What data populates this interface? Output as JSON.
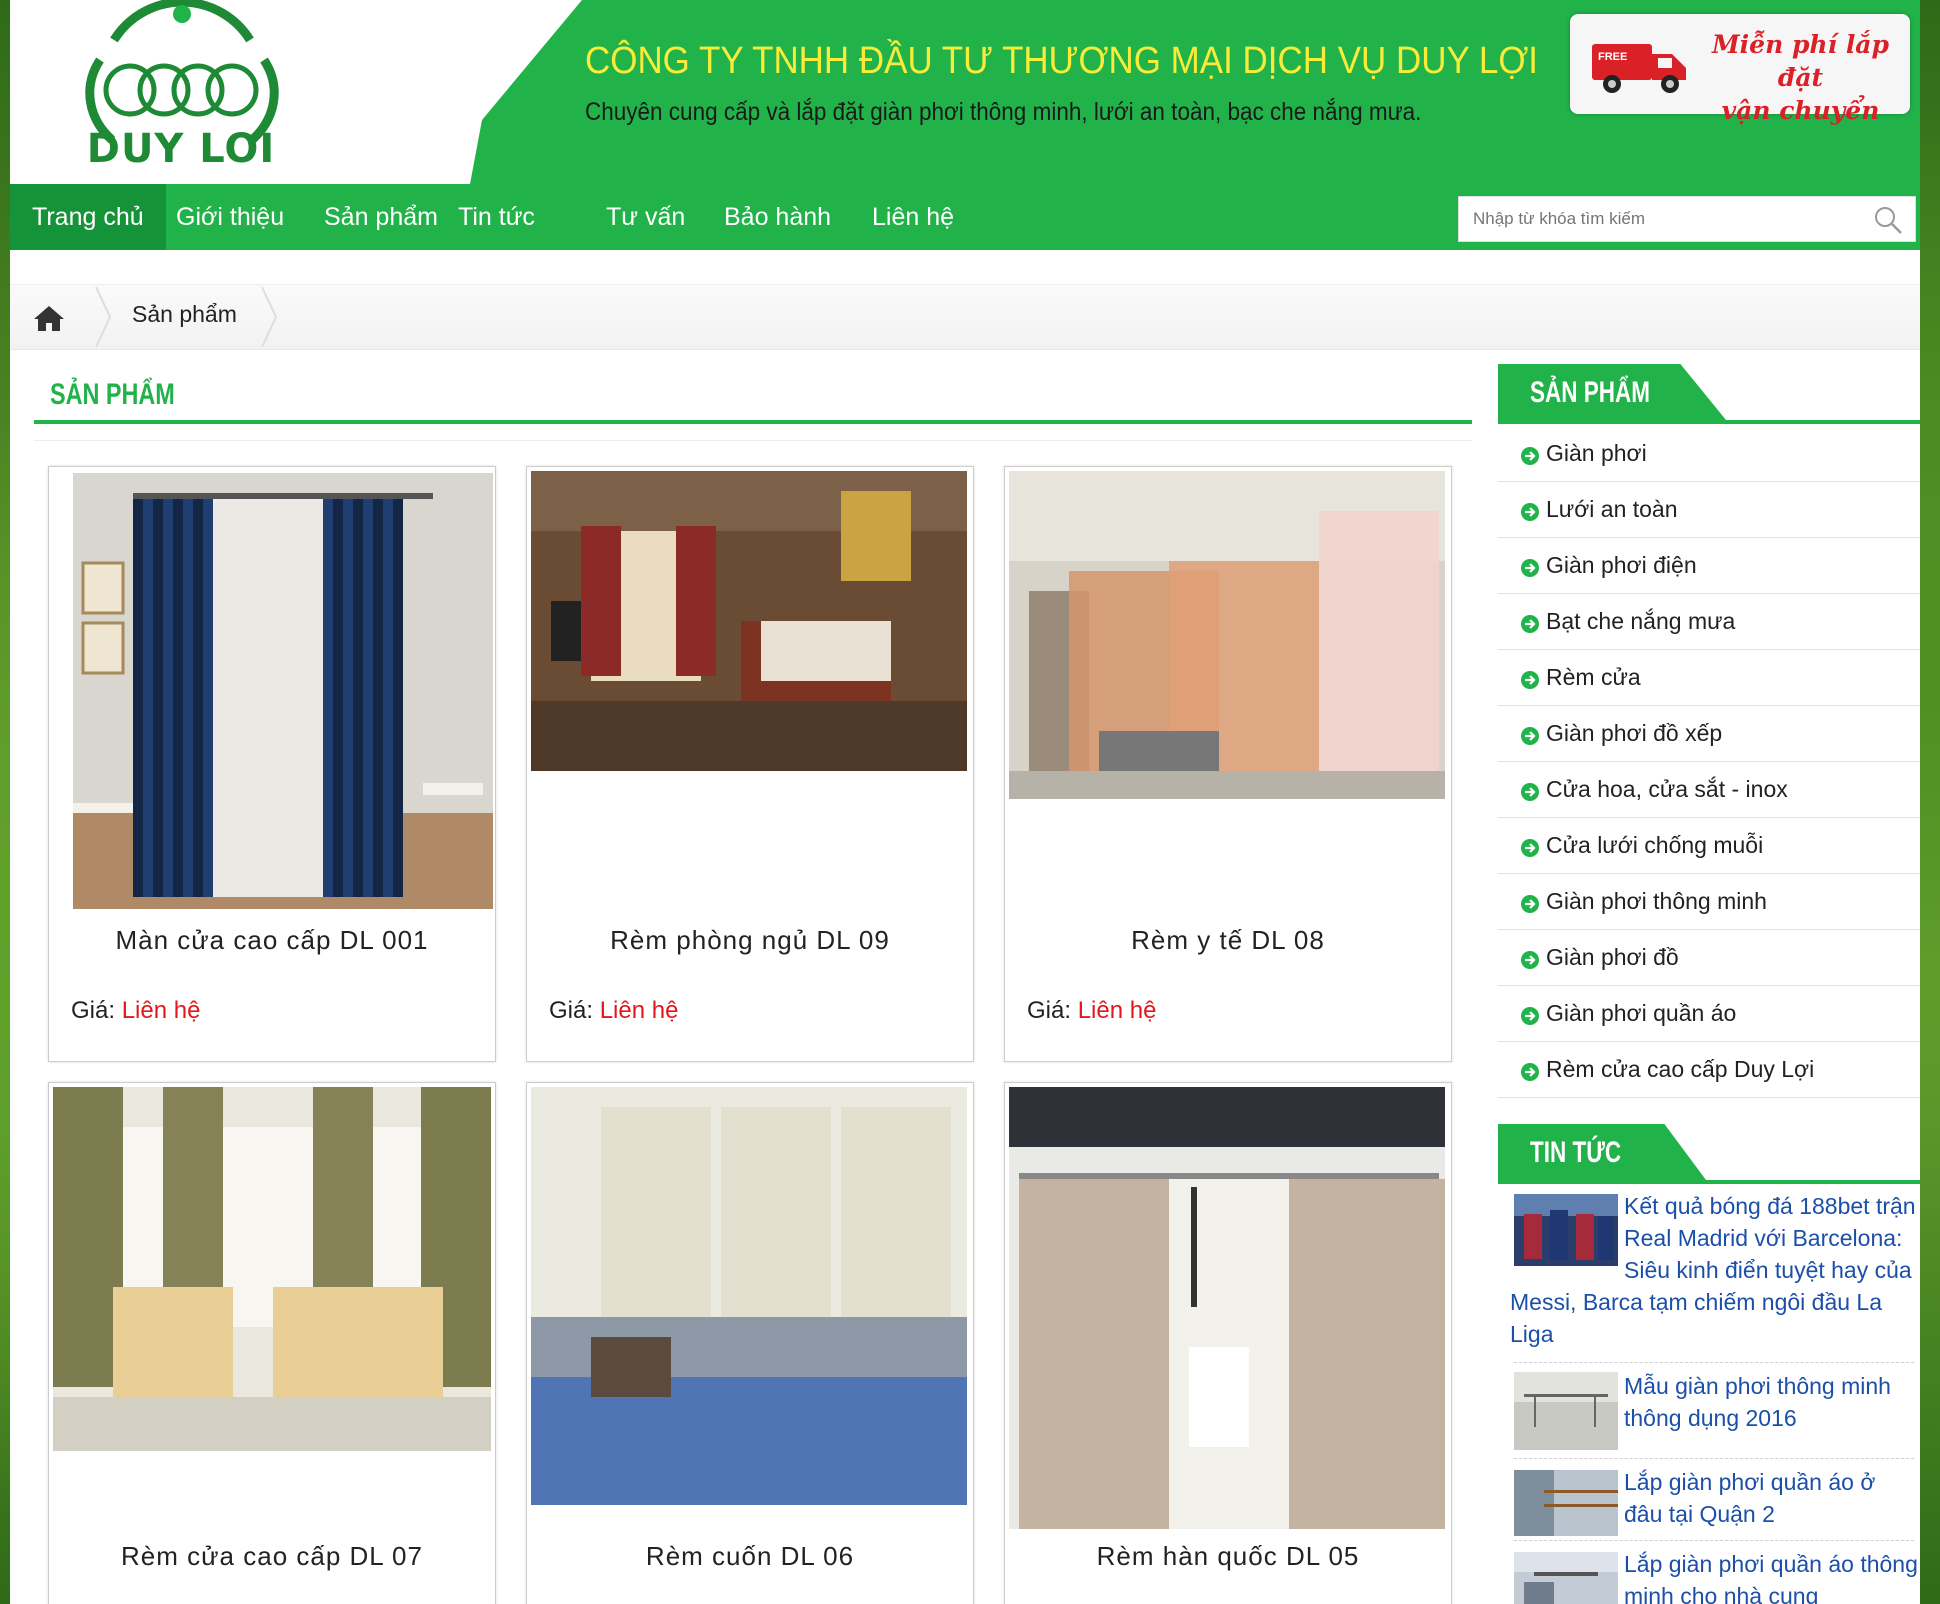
{
  "brand": {
    "logo_text": "DUY LOI",
    "company_name": "CÔNG TY TNHH ĐẦU TƯ THƯƠNG MẠI DỊCH VỤ DUY LỢI",
    "tagline": "Chuyên cung cấp và  lắp đặt giàn phơi thông minh, lưới an toàn, bạc che nắng mưa.",
    "promo_badge": "FREE",
    "promo_line1": "Miễn phí lắp đặt",
    "promo_line2": "vận chuyển"
  },
  "colors": {
    "primary": "#21b24a",
    "primary_dark": "#149338",
    "title_yellow": "#f7ec3a",
    "price_red": "#e3171b",
    "news_link": "#1b4fa8"
  },
  "nav": {
    "items": [
      {
        "label": "Trang chủ",
        "active": true
      },
      {
        "label": "Giới thiệu"
      },
      {
        "label": "Sản phẩm"
      },
      {
        "label": "Tin tức"
      },
      {
        "label": "Tư vấn"
      },
      {
        "label": "Bảo hành"
      },
      {
        "label": "Liên hệ"
      }
    ],
    "search_placeholder": "Nhập từ khóa tìm kiếm"
  },
  "breadcrumb": {
    "current": "Sản phẩm"
  },
  "main": {
    "title": "SẢN PHẨM",
    "price_label": "Giá:",
    "products": [
      {
        "name": "Màn cửa cao cấp DL 001",
        "price": "Liên hệ"
      },
      {
        "name": "Rèm phòng ngủ DL 09",
        "price": "Liên hệ"
      },
      {
        "name": "Rèm y tế DL 08",
        "price": "Liên hệ"
      },
      {
        "name": "Rèm cửa cao cấp DL 07"
      },
      {
        "name": "Rèm cuốn DL 06"
      },
      {
        "name": "Rèm hàn quốc DL 05"
      }
    ]
  },
  "sidebar": {
    "categories_title": "SẢN PHẨM",
    "categories": [
      "Giàn phơi",
      "Lưới an toàn",
      "Giàn phơi điện",
      "Bạt che nắng mưa",
      "Rèm cửa",
      "Giàn phơi đồ xếp",
      "Cửa hoa, cửa sắt - inox",
      "Cửa lưới chống muỗi",
      "Giàn phơi thông minh",
      "Giàn phơi đồ",
      "Giàn phơi quần áo",
      "Rèm cửa cao cấp Duy Lợi"
    ],
    "news_title": "TIN TỨC",
    "news": [
      "Kết quả bóng đá 188bet trận Real Madrid với Barcelona: Siêu kinh điển tuyệt hay của Messi, Barca tạm chiếm ngôi đầu La Liga",
      "Mẫu giàn phơi thông minh thông dụng 2016",
      "Lắp giàn phơi quần áo ở đâu tại Quận 2",
      "Lắp giàn phơi quần áo thông minh cho nhà cung"
    ]
  }
}
